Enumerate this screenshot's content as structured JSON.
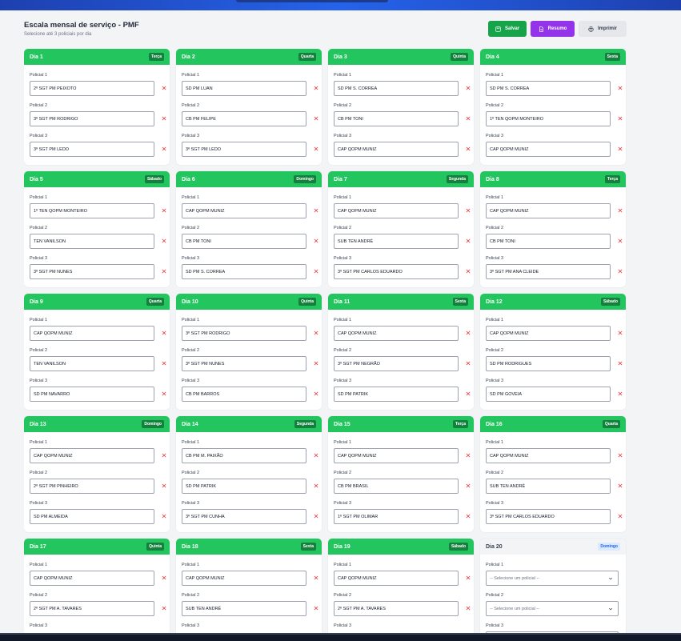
{
  "header": {
    "title": "Escala mensal de serviço - PMF",
    "subtitle": "Selecione até 3 policiais por dia",
    "save_label": "Salvar",
    "summary_label": "Resumo",
    "print_label": "Imprimir"
  },
  "slot_labels": [
    "Policial 1",
    "Policial 2",
    "Policial 3"
  ],
  "select_placeholder": "-- Selecione um policial --",
  "days": [
    {
      "label": "Dia 1",
      "weekday": "Terça",
      "officers": [
        "2º SGT PM PEIXOTO",
        "3º SGT PM RODRIGO",
        "3º SGT PM LEDO"
      ]
    },
    {
      "label": "Dia 2",
      "weekday": "Quarta",
      "officers": [
        "SD PM LUAN",
        "CB PM FELIPE",
        "3º SGT PM LEDO"
      ]
    },
    {
      "label": "Dia 3",
      "weekday": "Quinta",
      "officers": [
        "SD PM S. CORREA",
        "CB PM TONI",
        "CAP QOPM MUNIZ"
      ]
    },
    {
      "label": "Dia 4",
      "weekday": "Sexta",
      "officers": [
        "SD PM S. CORREA",
        "1º TEN QOPM MONTEIRO",
        "CAP QOPM MUNIZ"
      ]
    },
    {
      "label": "Dia 5",
      "weekday": "Sábado",
      "officers": [
        "1º TEN QOPM MONTEIRO",
        "TEN VANILSON",
        "3º SGT PM NUNES"
      ]
    },
    {
      "label": "Dia 6",
      "weekday": "Domingo",
      "officers": [
        "CAP QOPM MUNIZ",
        "CB PM TONI",
        "SD PM S. CORREA"
      ]
    },
    {
      "label": "Dia 7",
      "weekday": "Segunda",
      "officers": [
        "CAP QOPM MUNIZ",
        "SUB TEN ANDRÉ",
        "3º SGT PM CARLOS EDUARDO"
      ]
    },
    {
      "label": "Dia 8",
      "weekday": "Terça",
      "officers": [
        "CAP QOPM MUNIZ",
        "CB PM TONI",
        "3º SGT PM ANA CLEIDE"
      ]
    },
    {
      "label": "Dia 9",
      "weekday": "Quarta",
      "officers": [
        "CAP QOPM MUNIZ",
        "TEN VANILSON",
        "SD PM NAVARRO"
      ]
    },
    {
      "label": "Dia 10",
      "weekday": "Quinta",
      "officers": [
        "3º SGT PM RODRIGO",
        "3º SGT PM NUNES",
        "CB PM BARROS"
      ]
    },
    {
      "label": "Dia 11",
      "weekday": "Sexta",
      "officers": [
        "CAP QOPM MUNIZ",
        "3º SGT PM NEGRÃO",
        "SD PM PATRIK"
      ]
    },
    {
      "label": "Dia 12",
      "weekday": "Sábado",
      "officers": [
        "CAP QOPM MUNIZ",
        "SD PM RODRIGUES",
        "SD PM GOVEIA"
      ]
    },
    {
      "label": "Dia 13",
      "weekday": "Domingo",
      "officers": [
        "CAP QOPM MUNIZ",
        "2º SGT PM PINHEIRO",
        "SD PM ALMEIDA"
      ]
    },
    {
      "label": "Dia 14",
      "weekday": "Segunda",
      "officers": [
        "CB PM M. PAIXÃO",
        "SD PM PATRIK",
        "3º SGT PM CUNHA"
      ]
    },
    {
      "label": "Dia 15",
      "weekday": "Terça",
      "officers": [
        "CAP QOPM MUNIZ",
        "CB PM BRASIL",
        "1º SGT PM OLIMAR"
      ]
    },
    {
      "label": "Dia 16",
      "weekday": "Quarta",
      "officers": [
        "CAP QOPM MUNIZ",
        "SUB TEN ANDRÉ",
        "3º SGT PM CARLOS EDUARDO"
      ]
    },
    {
      "label": "Dia 17",
      "weekday": "Quinta",
      "officers": [
        "CAP QOPM MUNIZ",
        "2º SGT PM A. TAVARES",
        ""
      ]
    },
    {
      "label": "Dia 18",
      "weekday": "Sexta",
      "officers": [
        "CAP QOPM MUNIZ",
        "SUB TEN ANDRÉ",
        ""
      ]
    },
    {
      "label": "Dia 19",
      "weekday": "Sábado",
      "officers": [
        "CAP QOPM MUNIZ",
        "2º SGT PM A. TAVARES",
        ""
      ]
    },
    {
      "label": "Dia 20",
      "weekday": "Domingo",
      "officers": [
        "",
        "",
        ""
      ]
    }
  ],
  "colors": {
    "card_header": "#22c55e",
    "weekday_badge": "#15803d",
    "save": "#16a34a",
    "summary": "#9333ea",
    "remove_icon": "#ef4444"
  }
}
